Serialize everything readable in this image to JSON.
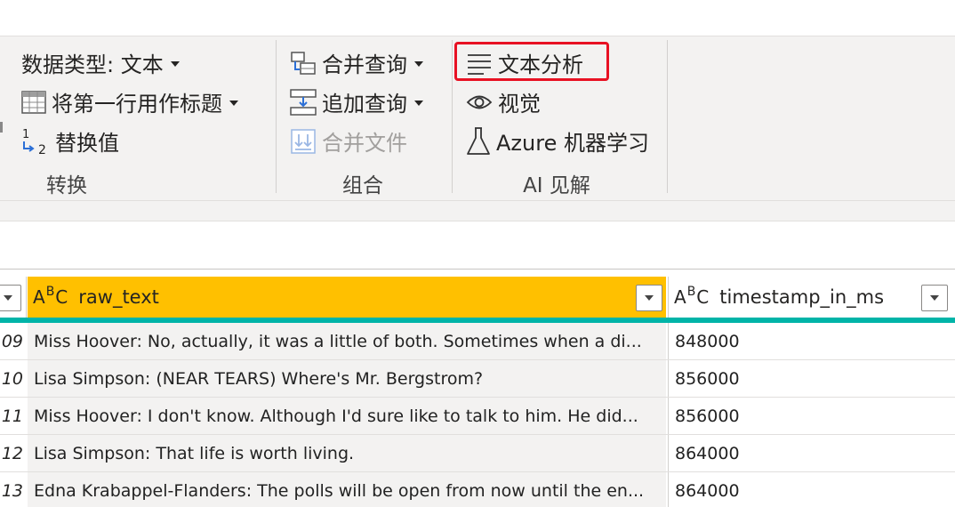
{
  "ribbon": {
    "transform": {
      "data_type": "数据类型: 文本",
      "use_first_row": "将第一行用作标题",
      "replace_values": "替换值",
      "group_label": "转换"
    },
    "combine": {
      "merge_queries": "合并查询",
      "append_queries": "追加查询",
      "combine_files": "合并文件",
      "group_label": "组合"
    },
    "ai_insights": {
      "text_analytics": "文本分析",
      "vision": "视觉",
      "azure_ml": "Azure 机器学习",
      "group_label": "AI 见解"
    }
  },
  "table": {
    "columns": [
      {
        "name": "raw_text",
        "type_icon": "ABC"
      },
      {
        "name": "timestamp_in_ms",
        "type_icon": "ABC"
      }
    ],
    "rows": [
      {
        "index": "09",
        "raw_text": "Miss Hoover: No, actually, it was a little of both. Sometimes when a di...",
        "timestamp": "848000"
      },
      {
        "index": "10",
        "raw_text": "Lisa Simpson: (NEAR TEARS) Where's Mr. Bergstrom?",
        "timestamp": "856000"
      },
      {
        "index": "11",
        "raw_text": "Miss Hoover: I don't know. Although I'd sure like to talk to him. He did...",
        "timestamp": "856000"
      },
      {
        "index": "12",
        "raw_text": "Lisa Simpson: That life is worth living.",
        "timestamp": "864000"
      },
      {
        "index": "13",
        "raw_text": "Edna Krabappel-Flanders: The polls will be open from now until the en...",
        "timestamp": "864000"
      }
    ]
  },
  "colors": {
    "selected_header": "#ffc000",
    "quality_bar": "#00b4a8",
    "highlight": "#e81123"
  }
}
